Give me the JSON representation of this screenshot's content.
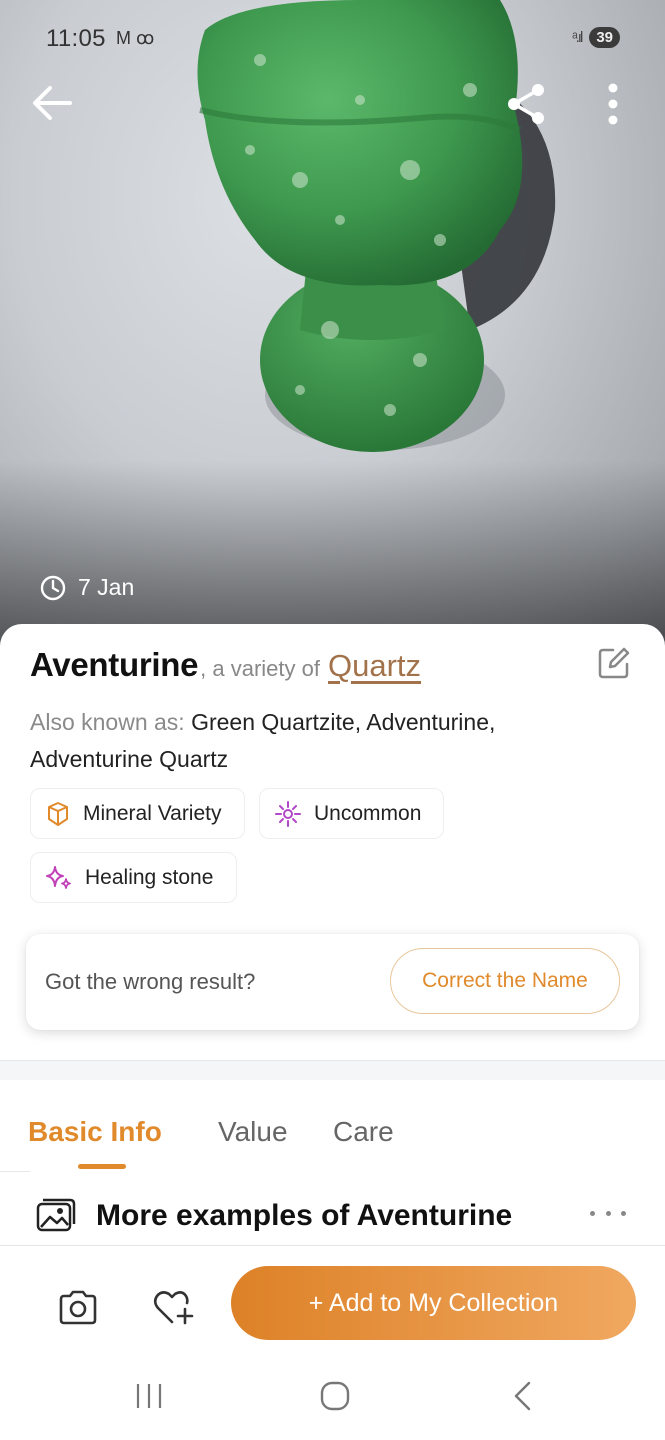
{
  "status_bar": {
    "time": "11:05",
    "notif_icons": "M ꝏ",
    "signal": "ᵃ.ıl",
    "battery": "39"
  },
  "hero": {
    "date": "7 Jan"
  },
  "result": {
    "name": "Aventurine",
    "variety_prefix": ", a variety of",
    "variety_link": "Quartz",
    "aka_label": "Also known as:",
    "aka_value": " Green Quartzite, Adventurine, Adventurine Quartz",
    "tags": [
      {
        "label": "Mineral Variety",
        "icon": "mineral-gem-icon",
        "color": "#e08a2c"
      },
      {
        "label": "Uncommon",
        "icon": "sparkle-burst-icon",
        "color": "#b247c9"
      },
      {
        "label": "Healing stone",
        "icon": "sparkles-icon",
        "color": "#c240b8"
      }
    ]
  },
  "wrong_card": {
    "text": "Got the wrong result?",
    "button": "Correct the Name"
  },
  "tabs": [
    {
      "label": "Basic Info",
      "active": true
    },
    {
      "label": "Value",
      "active": false
    },
    {
      "label": "Care",
      "active": false
    }
  ],
  "section": {
    "title": "More examples of Aventurine"
  },
  "actions": {
    "add_label": "+ Add to My Collection"
  },
  "colors": {
    "accent": "#e08a2c",
    "link": "#a2724a",
    "stone_green": "#3f9a4f"
  }
}
